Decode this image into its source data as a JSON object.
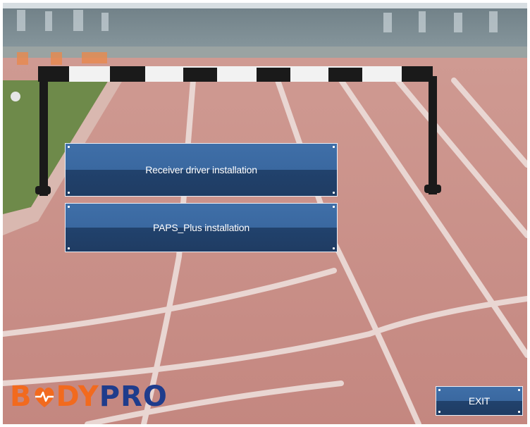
{
  "buttons": {
    "receiver_driver": "Receiver driver installation",
    "paps_plus": "PAPS_Plus installation",
    "exit": "EXIT"
  },
  "logo": {
    "text_orange_1": "B",
    "text_orange_2": "DY",
    "text_blue": "PRO",
    "icon": "heart-pulse-icon"
  },
  "colors": {
    "button_top": "#3f6fa8",
    "button_bottom": "#21426d",
    "logo_orange": "#f26a1e",
    "logo_blue": "#1f3c8c",
    "track": "#c98d86"
  }
}
